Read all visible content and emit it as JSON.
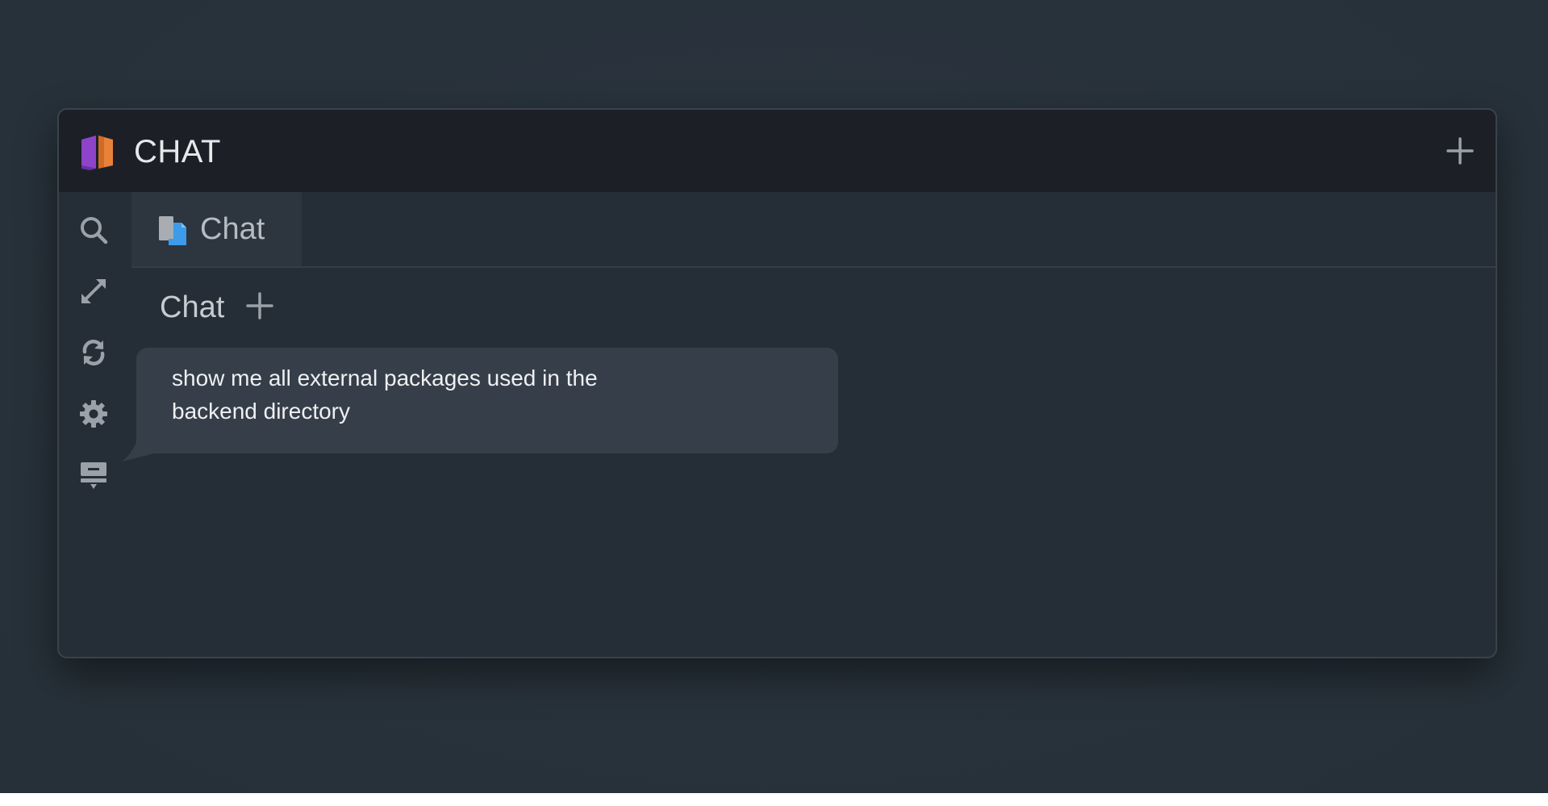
{
  "header": {
    "title": "CHAT",
    "logo_icon": "book-logo-icon",
    "add_icon": "plus-icon"
  },
  "sidebar": {
    "items": [
      {
        "icon": "search-icon",
        "label": "Search"
      },
      {
        "icon": "expand-icon",
        "label": "Expand"
      },
      {
        "icon": "refresh-icon",
        "label": "Refresh"
      },
      {
        "icon": "gear-icon",
        "label": "Settings"
      },
      {
        "icon": "pin-icon",
        "label": "Pin"
      }
    ]
  },
  "tabs": [
    {
      "label": "Chat",
      "icon": "document-icon",
      "active": true
    }
  ],
  "chat": {
    "section_title": "Chat",
    "messages": [
      {
        "role": "user",
        "text": "show me all external packages used in the backend directory"
      }
    ]
  },
  "colors": {
    "background": "#28323b",
    "window": "#252d36",
    "titlebar": "#1c2026",
    "bubble": "#363e49",
    "logo_purple": "#8e44c9",
    "logo_orange": "#e8823a",
    "tab_icon_blue": "#3d9be9"
  }
}
